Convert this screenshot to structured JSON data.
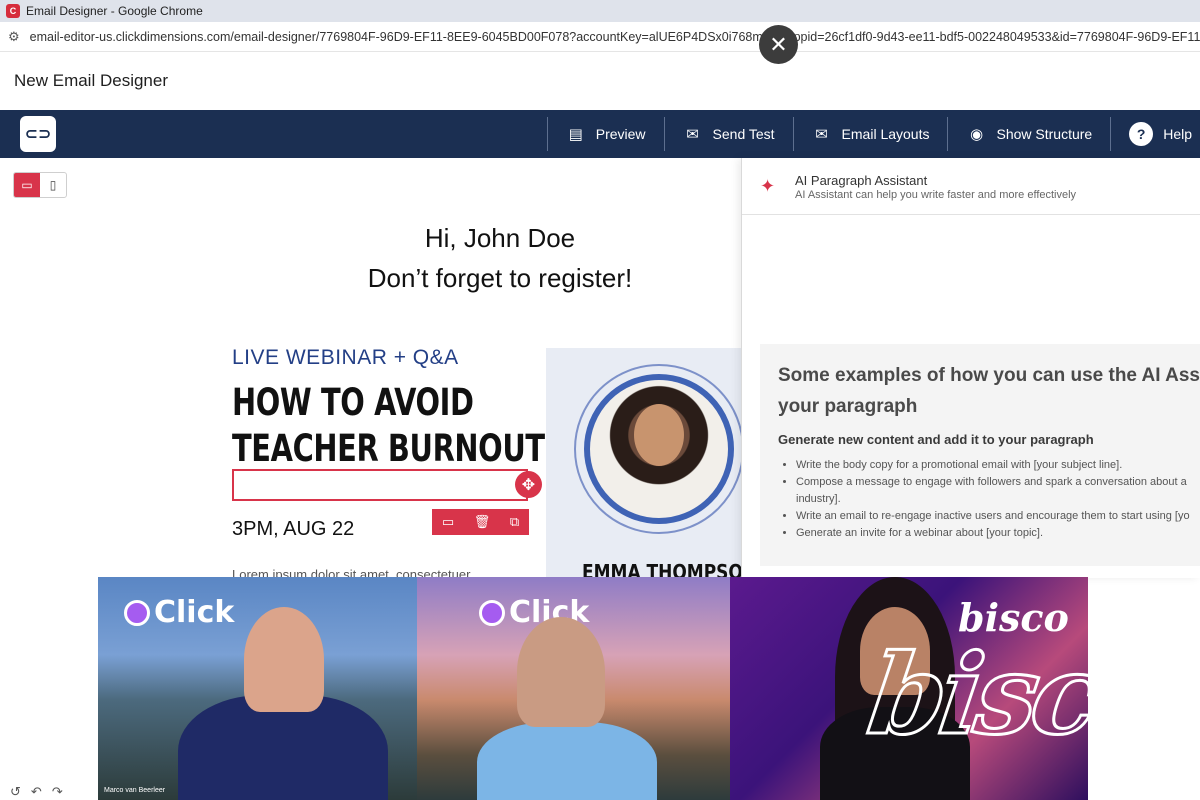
{
  "browser": {
    "window_title": "Email Designer - Google Chrome",
    "url": "email-editor-us.clickdimensions.com/email-designer/7769804F-96D9-EF11-8EE9-6045BD00F078?accountKey=alUE6P4DSx0i768mAv...appid=26cf1df0-9d43-ee11-bdf5-002248049533&id=7769804F-96D9-EF11-8"
  },
  "overlay": {
    "close_icon": "close-icon"
  },
  "page": {
    "title": "New Email Designer"
  },
  "toolbar": {
    "logo_text": "⊃",
    "preview_label": "Preview",
    "send_test_label": "Send Test",
    "email_layouts_label": "Email Layouts",
    "show_structure_label": "Show Structure",
    "help_label": "Help"
  },
  "email": {
    "greeting_line1": "Hi, John Doe",
    "greeting_line2": "Don’t forget to register!",
    "eyebrow": "LIVE WEBINAR + Q&A",
    "headline_line1": "HOW TO AVOID",
    "headline_line2": "TEACHER BURNOUT",
    "event_time": "3PM, AUG 22",
    "body_preview": "Lorem ipsum dolor sit amet, consectetuer",
    "speaker_name": "EMMA THOMPSON"
  },
  "ai_panel": {
    "title": "AI Paragraph Assistant",
    "subtitle": "AI Assistant can help you write faster and more effectively",
    "examples_heading_line1": "Some examples of how you can use the AI Ass",
    "examples_heading_line2": "your paragraph",
    "generate_heading": "Generate new content and add it to your paragraph",
    "examples": [
      "Write the body copy for a promotional email with [your subject line].",
      "Compose a message to engage with followers and spark a conversation about a",
      "industry].",
      "Write an email to re-engage inactive users and encourage them to start using [yo",
      "Generate an invite for a webinar about [your topic]."
    ]
  },
  "video": {
    "brand1": "Click",
    "brand2": "Click",
    "brand3": "bisco",
    "bisco_overlay": "bisco",
    "participant1_tag": "Marco van Beerleer"
  },
  "colors": {
    "navy": "#1b2f52",
    "accent_red": "#d8344a",
    "eyebrow_blue": "#233f86"
  }
}
